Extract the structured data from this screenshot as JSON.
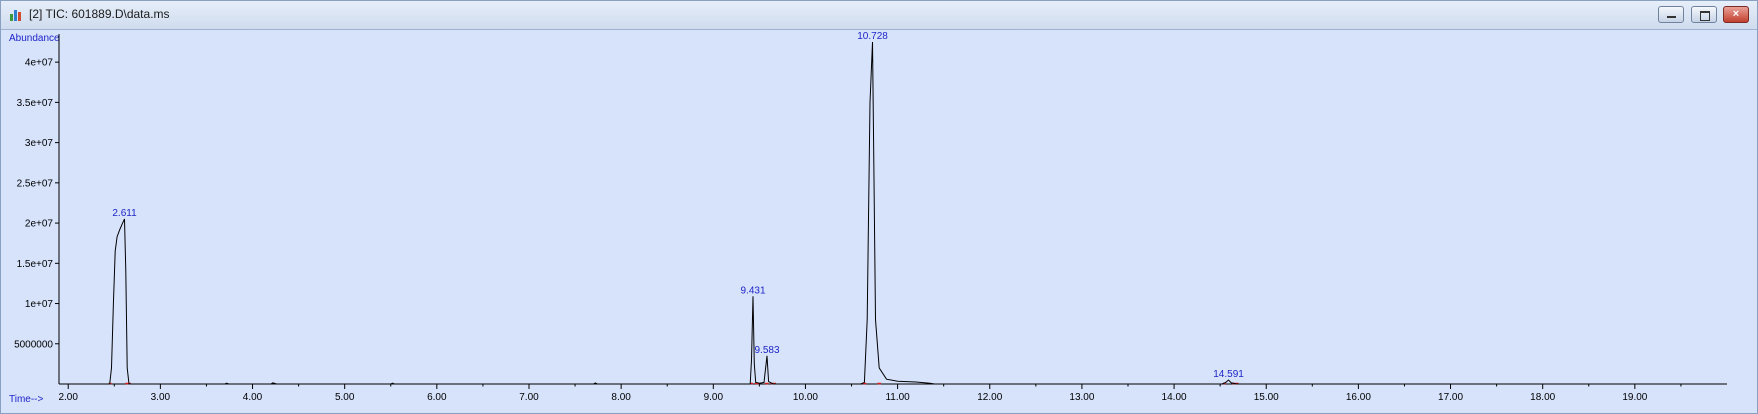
{
  "window": {
    "title": "[2] TIC: 601889.D\\data.ms",
    "icons": {
      "app": "chromatogram-icon",
      "minimize": "minimize-icon",
      "maximize": "maximize-icon",
      "close": "close-icon"
    },
    "close_glyph": "×"
  },
  "colors": {
    "plot_background": "#d6e3fb",
    "trace": "#000000",
    "peak_label": "#1e24c8",
    "baseline_marker": "#e0201e"
  },
  "chart_data": {
    "type": "line",
    "ylabel": "Abundance",
    "xlabel": "Time-->",
    "xlim": [
      1.9,
      20.0
    ],
    "ylim": [
      0,
      43000000
    ],
    "x_ticks": [
      "2.00",
      "3.00",
      "4.00",
      "5.00",
      "6.00",
      "7.00",
      "8.00",
      "9.00",
      "10.00",
      "11.00",
      "12.00",
      "13.00",
      "14.00",
      "15.00",
      "16.00",
      "17.00",
      "18.00",
      "19.00"
    ],
    "y_ticks": [
      {
        "value": 5000000,
        "label": "5000000"
      },
      {
        "value": 10000000,
        "label": "1e+07"
      },
      {
        "value": 15000000,
        "label": "1.5e+07"
      },
      {
        "value": 20000000,
        "label": "2e+07"
      },
      {
        "value": 25000000,
        "label": "2.5e+07"
      },
      {
        "value": 30000000,
        "label": "3e+07"
      },
      {
        "value": 35000000,
        "label": "3.5e+07"
      },
      {
        "value": 40000000,
        "label": "4e+07"
      }
    ],
    "peak_labels": [
      {
        "label": "2.611",
        "x": 2.611,
        "y": 20500000
      },
      {
        "label": "9.431",
        "x": 9.431,
        "y": 10900000
      },
      {
        "label": "9.583",
        "x": 9.583,
        "y": 3500000
      },
      {
        "label": "10.728",
        "x": 10.728,
        "y": 42500000
      },
      {
        "label": "14.591",
        "x": 14.591,
        "y": 500000
      }
    ],
    "series": [
      {
        "points": [
          [
            1.9,
            0
          ],
          [
            2.45,
            0
          ],
          [
            2.47,
            2000000
          ],
          [
            2.49,
            10000000
          ],
          [
            2.51,
            16500000
          ],
          [
            2.53,
            18300000
          ],
          [
            2.56,
            19200000
          ],
          [
            2.59,
            20000000
          ],
          [
            2.611,
            20500000
          ],
          [
            2.625,
            14000000
          ],
          [
            2.64,
            2000000
          ],
          [
            2.66,
            0
          ],
          [
            3.7,
            0
          ],
          [
            3.72,
            100000
          ],
          [
            3.74,
            0
          ],
          [
            4.2,
            0
          ],
          [
            4.22,
            150000
          ],
          [
            4.26,
            0
          ],
          [
            5.5,
            0
          ],
          [
            5.52,
            100000
          ],
          [
            5.54,
            0
          ],
          [
            7.7,
            0
          ],
          [
            7.72,
            120000
          ],
          [
            7.74,
            0
          ],
          [
            9.4,
            0
          ],
          [
            9.415,
            3000000
          ],
          [
            9.431,
            10900000
          ],
          [
            9.445,
            2500000
          ],
          [
            9.46,
            200000
          ],
          [
            9.5,
            100000
          ],
          [
            9.55,
            200000
          ],
          [
            9.583,
            3500000
          ],
          [
            9.6,
            300000
          ],
          [
            9.65,
            0
          ],
          [
            10.6,
            0
          ],
          [
            10.64,
            200000
          ],
          [
            10.67,
            8000000
          ],
          [
            10.7,
            35000000
          ],
          [
            10.728,
            42500000
          ],
          [
            10.74,
            30000000
          ],
          [
            10.76,
            8000000
          ],
          [
            10.8,
            2000000
          ],
          [
            10.88,
            600000
          ],
          [
            11.0,
            350000
          ],
          [
            11.2,
            250000
          ],
          [
            11.35,
            100000
          ],
          [
            11.4,
            0
          ],
          [
            14.52,
            0
          ],
          [
            14.56,
            200000
          ],
          [
            14.591,
            500000
          ],
          [
            14.62,
            150000
          ],
          [
            14.68,
            0
          ],
          [
            20.0,
            0
          ]
        ]
      }
    ],
    "baseline_markers": [
      [
        2.44,
        2.47
      ],
      [
        2.62,
        2.68
      ],
      [
        9.4,
        9.43
      ],
      [
        9.45,
        9.5
      ],
      [
        9.56,
        9.6
      ],
      [
        9.62,
        9.68
      ],
      [
        10.62,
        10.66
      ],
      [
        10.78,
        10.82
      ],
      [
        14.53,
        14.56
      ],
      [
        14.63,
        14.7
      ]
    ]
  }
}
